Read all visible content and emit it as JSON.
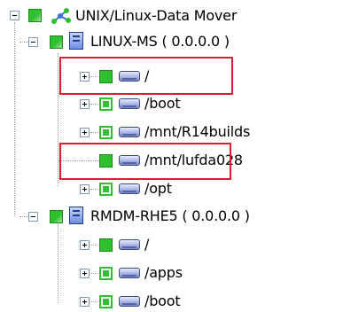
{
  "tree": {
    "root": {
      "label": "UNIX/Linux-Data Mover"
    },
    "hosts": [
      {
        "label": "LINUX-MS ( 0.0.0.0 )",
        "items": [
          {
            "label": "/"
          },
          {
            "label": "/boot"
          },
          {
            "label": "/mnt/R14builds"
          },
          {
            "label": "/mnt/lufda028"
          },
          {
            "label": "/opt"
          }
        ]
      },
      {
        "label": "RMDM-RHE5 ( 0.0.0.0 )",
        "items": [
          {
            "label": "/"
          },
          {
            "label": "/apps"
          },
          {
            "label": "/boot"
          }
        ]
      }
    ]
  },
  "colors": {
    "highlight": "#d2222d",
    "check_green": "#2fbf2f",
    "drive_blue": "#7e8cc9"
  },
  "icons": {
    "root": "network-icon",
    "host": "server-icon",
    "volume": "drive-icon"
  }
}
